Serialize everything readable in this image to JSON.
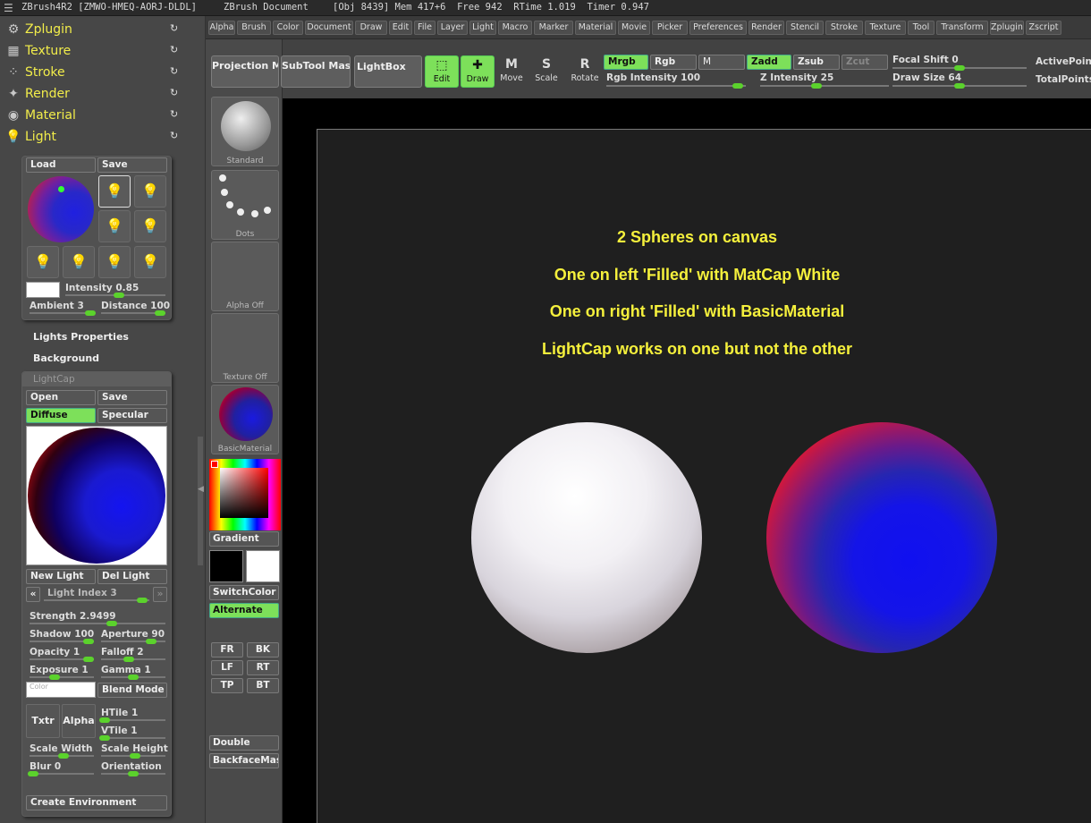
{
  "titlebar": {
    "app": "ZBrush4R2 [ZMWO-HMEQ-AORJ-DLDL]",
    "doc": "ZBrush Document",
    "stats": "[Obj 8439] Mem 417+6  Free 942  RTime 1.019  Timer 0.947"
  },
  "menu": [
    "Alpha",
    "Brush",
    "Color",
    "Document",
    "Draw",
    "Edit",
    "File",
    "Layer",
    "Light",
    "Macro",
    "Marker",
    "Material",
    "Movie",
    "Picker",
    "Preferences",
    "Render",
    "Stencil",
    "Stroke",
    "Texture",
    "Tool",
    "Transform",
    "Zplugin",
    "Zscript"
  ],
  "palettes": [
    {
      "label": "Zplugin",
      "icon": "plugin-icon"
    },
    {
      "label": "Texture",
      "icon": "texture-icon"
    },
    {
      "label": "Stroke",
      "icon": "stroke-icon"
    },
    {
      "label": "Render",
      "icon": "render-icon"
    },
    {
      "label": "Material",
      "icon": "material-icon"
    },
    {
      "label": "Light",
      "icon": "lightbulb-icon"
    }
  ],
  "light": {
    "load": "Load",
    "save": "Save",
    "intensity_label": "Intensity",
    "intensity_value": "0.85",
    "ambient_label": "Ambient",
    "ambient_value": "3",
    "distance_label": "Distance",
    "distance_value": "100",
    "lights_properties": "Lights Properties",
    "background": "Background"
  },
  "lightcap": {
    "title": "LightCap",
    "open": "Open",
    "save": "Save",
    "diffuse": "Diffuse",
    "specular": "Specular",
    "new_light": "New Light",
    "del_light": "Del Light",
    "light_index_label": "Light Index",
    "light_index_value": "3",
    "strength_label": "Strength",
    "strength_value": "2.9499",
    "shadow_label": "Shadow",
    "shadow_value": "100",
    "aperture_label": "Aperture",
    "aperture_value": "90",
    "opacity_label": "Opacity",
    "opacity_value": "1",
    "falloff_label": "Falloff",
    "falloff_value": "2",
    "exposure_label": "Exposure",
    "exposure_value": "1",
    "gamma_label": "Gamma",
    "gamma_value": "1",
    "color_placeholder": "Color",
    "blend_mode": "Blend Mode",
    "txtr": "Txtr",
    "alpha": "Alpha",
    "htile_label": "HTile",
    "htile_value": "1",
    "vtile_label": "VTile",
    "vtile_value": "1",
    "scale_width": "Scale Width",
    "scale_height": "Scale Height",
    "blur_label": "Blur",
    "blur_value": "0",
    "orientation": "Orientation",
    "create_env": "Create Environment"
  },
  "shelf": {
    "brush": "Standard",
    "stroke": "Dots",
    "alpha": "Alpha Off",
    "texture": "Texture Off",
    "material": "BasicMaterial",
    "gradient": "Gradient",
    "switchcolor": "SwitchColor",
    "alternate": "Alternate",
    "views": [
      "FR",
      "BK",
      "LF",
      "RT",
      "TP",
      "BT"
    ],
    "double": "Double",
    "backface": "BackfaceMas"
  },
  "toolbar": {
    "projection_master": "Projection Master",
    "subtool_master": "SubTool Master",
    "lightbox": "LightBox",
    "edit": "Edit",
    "draw": "Draw",
    "move": "Move",
    "scale": "Scale",
    "rotate": "Rotate",
    "mrgb": "Mrgb",
    "rgb": "Rgb",
    "m": "M",
    "rgb_intensity_label": "Rgb Intensity",
    "rgb_intensity_value": "100",
    "zadd": "Zadd",
    "zsub": "Zsub",
    "zcut": "Zcut",
    "z_intensity_label": "Z Intensity",
    "z_intensity_value": "25",
    "focal_shift_label": "Focal Shift",
    "focal_shift_value": "0",
    "draw_size_label": "Draw Size",
    "draw_size_value": "64",
    "active_points": "ActivePoin",
    "total_points": "TotalPoints"
  },
  "canvas": {
    "lines": [
      "2 Spheres on canvas",
      "One on left 'Filled' with MatCap White",
      "One on right 'Filled' with BasicMaterial",
      "LightCap works on one but not the other"
    ]
  },
  "colors": {
    "palette_label": "#f2ed4a",
    "active_green": "#7de05a",
    "canvas_text": "#f5f03c"
  }
}
